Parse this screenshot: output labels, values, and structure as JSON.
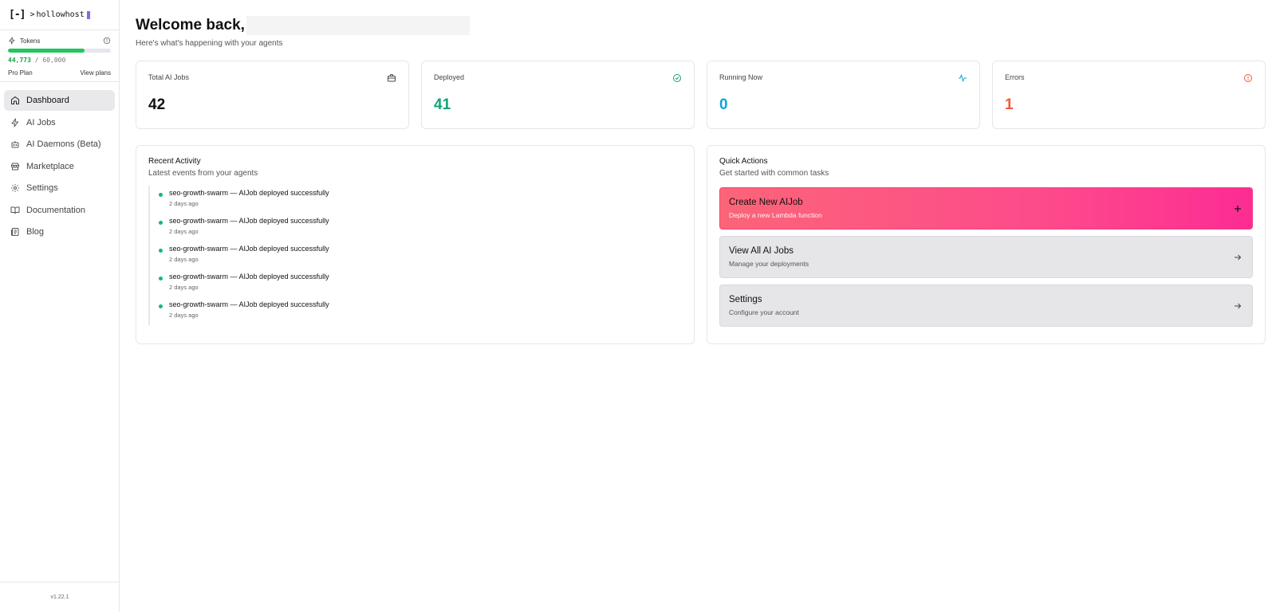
{
  "sidebar": {
    "logo": {
      "bracket": "[-]",
      "prompt": ">",
      "name": "hollowhost"
    },
    "tokens": {
      "label": "Tokens",
      "used": "44,773",
      "separator": "/",
      "total": "60,000",
      "used_fraction": 0.746,
      "plan": "Pro Plan",
      "view_plans": "View plans"
    },
    "nav": [
      {
        "label": "Dashboard",
        "icon": "home-icon",
        "active": true
      },
      {
        "label": "AI Jobs",
        "icon": "bolt-icon"
      },
      {
        "label": "AI Daemons (Beta)",
        "icon": "bot-icon"
      },
      {
        "label": "Marketplace",
        "icon": "store-icon"
      },
      {
        "label": "Settings",
        "icon": "gear-icon"
      },
      {
        "label": "Documentation",
        "icon": "book-icon"
      },
      {
        "label": "Blog",
        "icon": "newspaper-icon"
      }
    ],
    "version": "v1.22.1"
  },
  "header": {
    "welcome": "Welcome back,",
    "subtitle": "Here's what's happening with your agents"
  },
  "stats": [
    {
      "label": "Total AI Jobs",
      "value": "42",
      "color": "#111111",
      "icon": "briefcase-icon"
    },
    {
      "label": "Deployed",
      "value": "41",
      "color": "#16a37a",
      "icon": "check-circle-icon"
    },
    {
      "label": "Running Now",
      "value": "0",
      "color": "#0ea5d8",
      "icon": "activity-icon"
    },
    {
      "label": "Errors",
      "value": "1",
      "color": "#ef5a3c",
      "icon": "alert-circle-icon"
    }
  ],
  "recent_activity": {
    "title": "Recent Activity",
    "subtitle": "Latest events from your agents",
    "items": [
      {
        "agent": "seo-growth-swarm",
        "separator": " — ",
        "event": "AIJob deployed successfully",
        "time": "2 days ago"
      },
      {
        "agent": "seo-growth-swarm",
        "separator": " — ",
        "event": "AIJob deployed successfully",
        "time": "2 days ago"
      },
      {
        "agent": "seo-growth-swarm",
        "separator": " — ",
        "event": "AIJob deployed successfully",
        "time": "2 days ago"
      },
      {
        "agent": "seo-growth-swarm",
        "separator": " — ",
        "event": "AIJob deployed successfully",
        "time": "2 days ago"
      },
      {
        "agent": "seo-growth-swarm",
        "separator": " — ",
        "event": "AIJob deployed successfully",
        "time": "2 days ago"
      }
    ]
  },
  "quick_actions": {
    "title": "Quick Actions",
    "subtitle": "Get started with common tasks",
    "items": [
      {
        "title": "Create New AIJob",
        "subtitle": "Deploy a new Lambda function",
        "icon": "plus-icon"
      },
      {
        "title": "View All AI Jobs",
        "subtitle": "Manage your deployments",
        "icon": "arrow-right-icon"
      },
      {
        "title": "Settings",
        "subtitle": "Configure your account",
        "icon": "arrow-right-icon"
      }
    ]
  },
  "colors": {
    "accent_green": "#22c55e",
    "primary_gradient_start": "#fb6578",
    "primary_gradient_end": "#fd2c93"
  }
}
